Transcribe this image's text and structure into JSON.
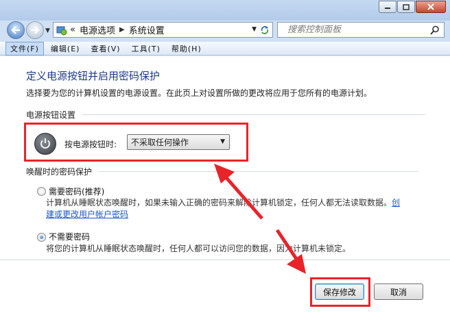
{
  "navigation": {
    "breadcrumb_prefix": "«",
    "breadcrumbs": [
      "电源选项",
      "系统设置"
    ],
    "search_placeholder": "搜索控制面板"
  },
  "menu": {
    "items": [
      "文件(F)",
      "编辑(E)",
      "查看(V)",
      "工具(T)",
      "帮助(H)"
    ]
  },
  "page": {
    "title": "定义电源按钮并启用密码保护",
    "description": "选择要为您的计算机设置的电源设置。在此页上对设置所做的更改将应用于您所有的电源计划。"
  },
  "power_section": {
    "header": "电源按钮设置",
    "label": "按电源按钮时:",
    "selected_value": "不采取任何操作"
  },
  "wake_section": {
    "header": "唤醒时的密码保护",
    "require": {
      "label": "需要密码(推荐)",
      "description": "计算机从睡眠状态唤醒时，如果未输入正确的密码来解除计算机锁定，任何人都无法读取数据。",
      "link_part1": "创",
      "link_part2": "建或更改用户帐户密码",
      "checked": false
    },
    "no_require": {
      "label": "不需要密码",
      "description": "将您的计算机从睡眠状态唤醒时，任何人都可以访问您的数据，因为计算机未锁定。",
      "checked": true
    }
  },
  "buttons": {
    "save": "保存修改",
    "cancel": "取消"
  },
  "colors": {
    "annotation_red": "#e8232a",
    "title_blue": "#1e3a8a",
    "link_blue": "#1a56c9"
  }
}
